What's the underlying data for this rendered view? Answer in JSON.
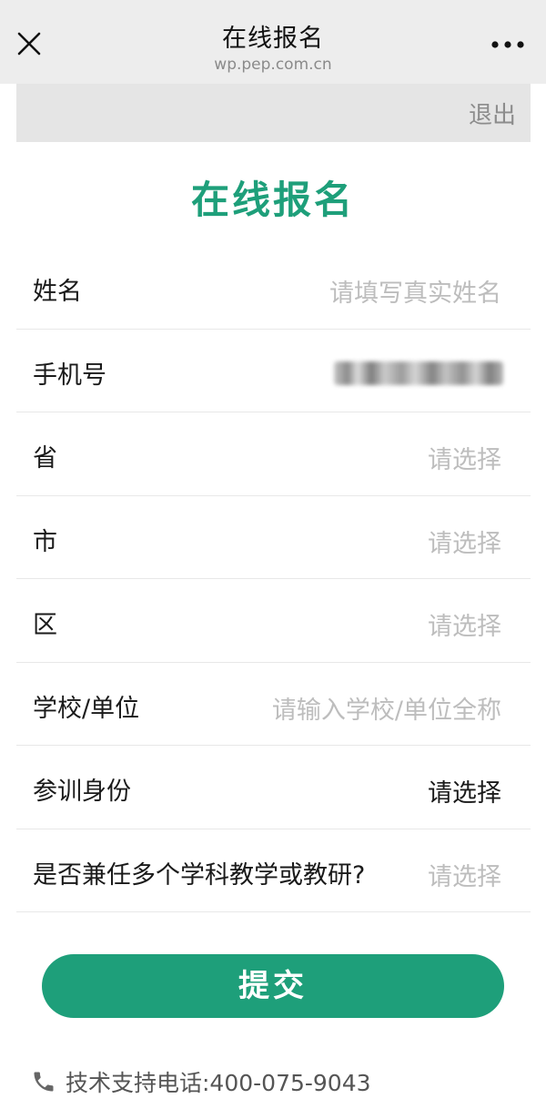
{
  "nav": {
    "title": "在线报名",
    "url": "wp.pep.com.cn"
  },
  "header": {
    "logout_label": "退出"
  },
  "page": {
    "title": "在线报名"
  },
  "form": {
    "fields": [
      {
        "label": "姓名",
        "value": "请填写真实姓名"
      },
      {
        "label": "手机号",
        "value": ""
      },
      {
        "label": "省",
        "value": "请选择"
      },
      {
        "label": "市",
        "value": "请选择"
      },
      {
        "label": "区",
        "value": "请选择"
      },
      {
        "label": "学校/单位",
        "value": "请输入学校/单位全称"
      },
      {
        "label": "参训身份",
        "value": "请选择"
      },
      {
        "label": "是否兼任多个学科教学或教研?",
        "value": "请选择"
      }
    ],
    "submit_label": "提交"
  },
  "support": {
    "text": "技术支持电话:400-075-9043"
  },
  "colors": {
    "accent": "#1e9f7a",
    "placeholder": "#bdbdbd",
    "nav_bg": "#ededed"
  },
  "icons": {
    "close": "close-icon",
    "more": "more-icon",
    "phone": "phone-icon"
  }
}
